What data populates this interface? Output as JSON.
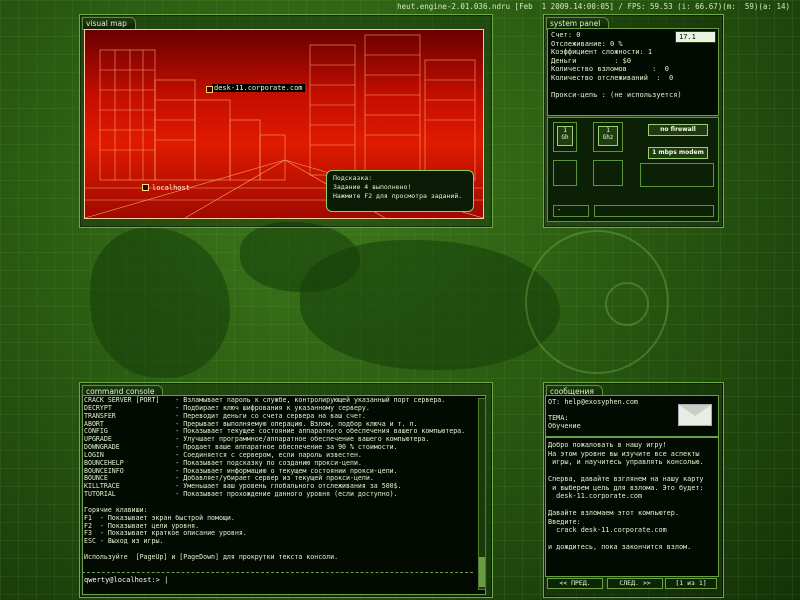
{
  "status_bar": "heut.engine-2.01.036.ndru [Feb  1 2009.14:00:05] / FPS: 59.53 (i: 66.67)(m:  59)(a: 14)",
  "visual_map": {
    "title": "visual map",
    "node_target": "desk-11.corporate.com",
    "node_local": "localhost",
    "hint_title": "Подсказка:",
    "hint_line1": "Задание 4 выполнено!",
    "hint_line2": "Нажмите F2 для просмотра заданий."
  },
  "system_panel": {
    "title": "system panel",
    "badge": "17.1",
    "lines": [
      "Счет: 0",
      "Отслеживание: 0 %",
      "Коэффициент сложности: 1",
      "Деньги         : $0",
      "Количество взломов      :  0",
      "Количество отслеживаний  :  0",
      "",
      "Прокси-цепь : (не используется)"
    ],
    "hw": {
      "cpu1": "1\nGh",
      "cpu2": "1\nGhz",
      "firewall": "no firewall",
      "modem": "1 mbps modem",
      "slot": "-"
    }
  },
  "console": {
    "title": "command console",
    "commands": [
      [
        "CRACK SERVER [PORT]",
        "Взламывает пароль к службе, контролирующей указанный порт сервера."
      ],
      [
        "DECRYPT",
        "Подбирает ключ шифрования к указанному серверу."
      ],
      [
        "TRANSFER",
        "Переводит деньги со счета сервера на ваш счет."
      ],
      [
        "ABORT",
        "Прерывает выполняемую операцию. Взлом, подбор ключа и т. п."
      ],
      [
        "CONFIG",
        "Показывает текущее состояние аппаратного обеспечения вашего компьютера."
      ],
      [
        "UPGRADE",
        "Улучшает программное/аппаратное обеспечение вашего компьютера."
      ],
      [
        "DOWNGRADE",
        "Продает ваше аппаратное обеспечение за 90 % стоимости."
      ],
      [
        "LOGIN",
        "Соединяется с сервером, если пароль известен."
      ],
      [
        "BOUNCEHELP",
        "Показывает подсказку по созданию прокси-цепи."
      ],
      [
        "BOUNCEINFO",
        "Показывает информацию о текущем состоянии прокси-цепи."
      ],
      [
        "BOUNCE",
        "Добавляет/убирает сервер из текущей прокси-цепи."
      ],
      [
        "KILLTRACE",
        "Уменьшает ваш уровень глобального отслеживания за 500$."
      ],
      [
        "TUTORIAL",
        "Показывает прохождение данного уровня (если доступно)."
      ]
    ],
    "hotkeys_title": "Горячие клавиши:",
    "hotkeys": [
      "F1  - Показывает экран быстрой помощи.",
      "F2  - Показывает цели уровня.",
      "F3  - Показывает краткое описание уровня.",
      "ESC - Выход из игры."
    ],
    "scroll_hint": "Используйте  [PageUp] и [PageDown] для прокрутки текста консоли.",
    "prompt": "qwerty@localhost:> |"
  },
  "messages": {
    "title": "сообщения",
    "from": "ОТ: help@exosyphen.com",
    "subject_label": "ТЕМА:",
    "subject": "Обучение",
    "body": "Добро пожаловать в нашу игру!\nНа этом уровне вы изучите все аспекты\n игры, и научитесь управлять консолью.\n\nСперва, давайте взглянем на нашу карту\n и выберем цель для взлома. Это будет:\n  desk-11.corporate.com\n\nДавайте взломаем этот компьютер.\nВведите:\n  crack desk-11.corporate.com\n\nи дождитесь, пока закончится взлом.",
    "prev": "<< ПРЕД.",
    "next": "СЛЕД. >>",
    "page": "[1 из 1]"
  }
}
